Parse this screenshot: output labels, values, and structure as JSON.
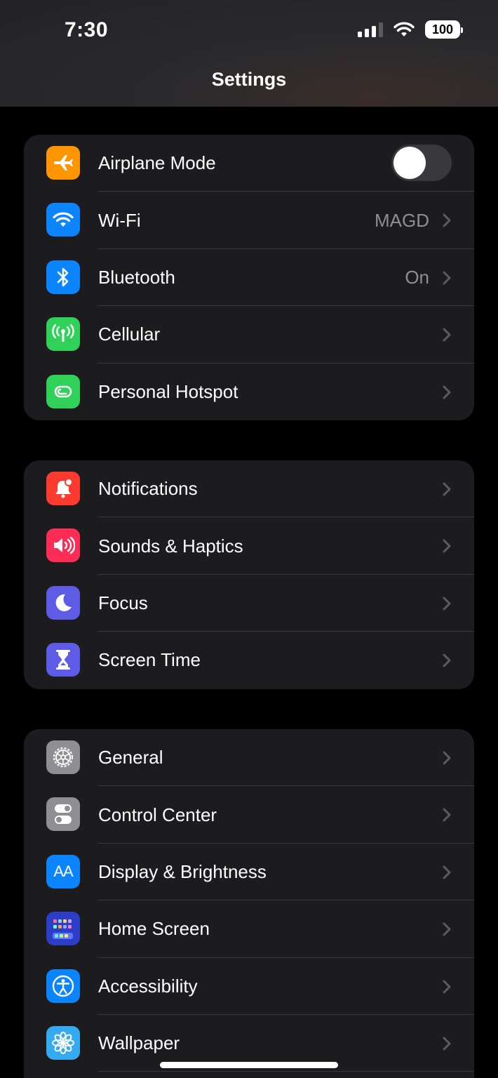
{
  "status_bar": {
    "time": "7:30",
    "battery": "100",
    "icons": [
      "signal-icon",
      "wifi-icon",
      "battery-icon"
    ]
  },
  "header": {
    "title": "Settings"
  },
  "groups": [
    {
      "items": [
        {
          "label": "Airplane Mode",
          "icon": "airplane-icon",
          "color": "#ff9500",
          "control": "toggle",
          "toggle_on": false
        },
        {
          "label": "Wi-Fi",
          "value": "MAGD",
          "icon": "wifi-icon",
          "color": "#0a84ff"
        },
        {
          "label": "Bluetooth",
          "value": "On",
          "icon": "bluetooth-icon",
          "color": "#0a84ff"
        },
        {
          "label": "Cellular",
          "icon": "cellular-icon",
          "color": "#30d158"
        },
        {
          "label": "Personal Hotspot",
          "icon": "hotspot-icon",
          "color": "#30d158"
        }
      ]
    },
    {
      "items": [
        {
          "label": "Notifications",
          "icon": "bell-icon",
          "color": "#ff3b30"
        },
        {
          "label": "Sounds & Haptics",
          "icon": "speaker-icon",
          "color": "#ff2d55"
        },
        {
          "label": "Focus",
          "icon": "moon-icon",
          "color": "#5e5ce6"
        },
        {
          "label": "Screen Time",
          "icon": "hourglass-icon",
          "color": "#5e5ce6"
        }
      ]
    },
    {
      "items": [
        {
          "label": "General",
          "icon": "gear-icon",
          "color": "#8e8e93"
        },
        {
          "label": "Control Center",
          "icon": "switches-icon",
          "color": "#8e8e93"
        },
        {
          "label": "Display & Brightness",
          "icon": "text-size-icon",
          "icon_text": "AA",
          "color": "#0a84ff"
        },
        {
          "label": "Home Screen",
          "icon": "home-grid-icon",
          "color": "#2c3ec8"
        },
        {
          "label": "Accessibility",
          "icon": "accessibility-icon",
          "color": "#0a84ff"
        },
        {
          "label": "Wallpaper",
          "icon": "flower-icon",
          "color": "#35aaf0"
        }
      ]
    }
  ]
}
